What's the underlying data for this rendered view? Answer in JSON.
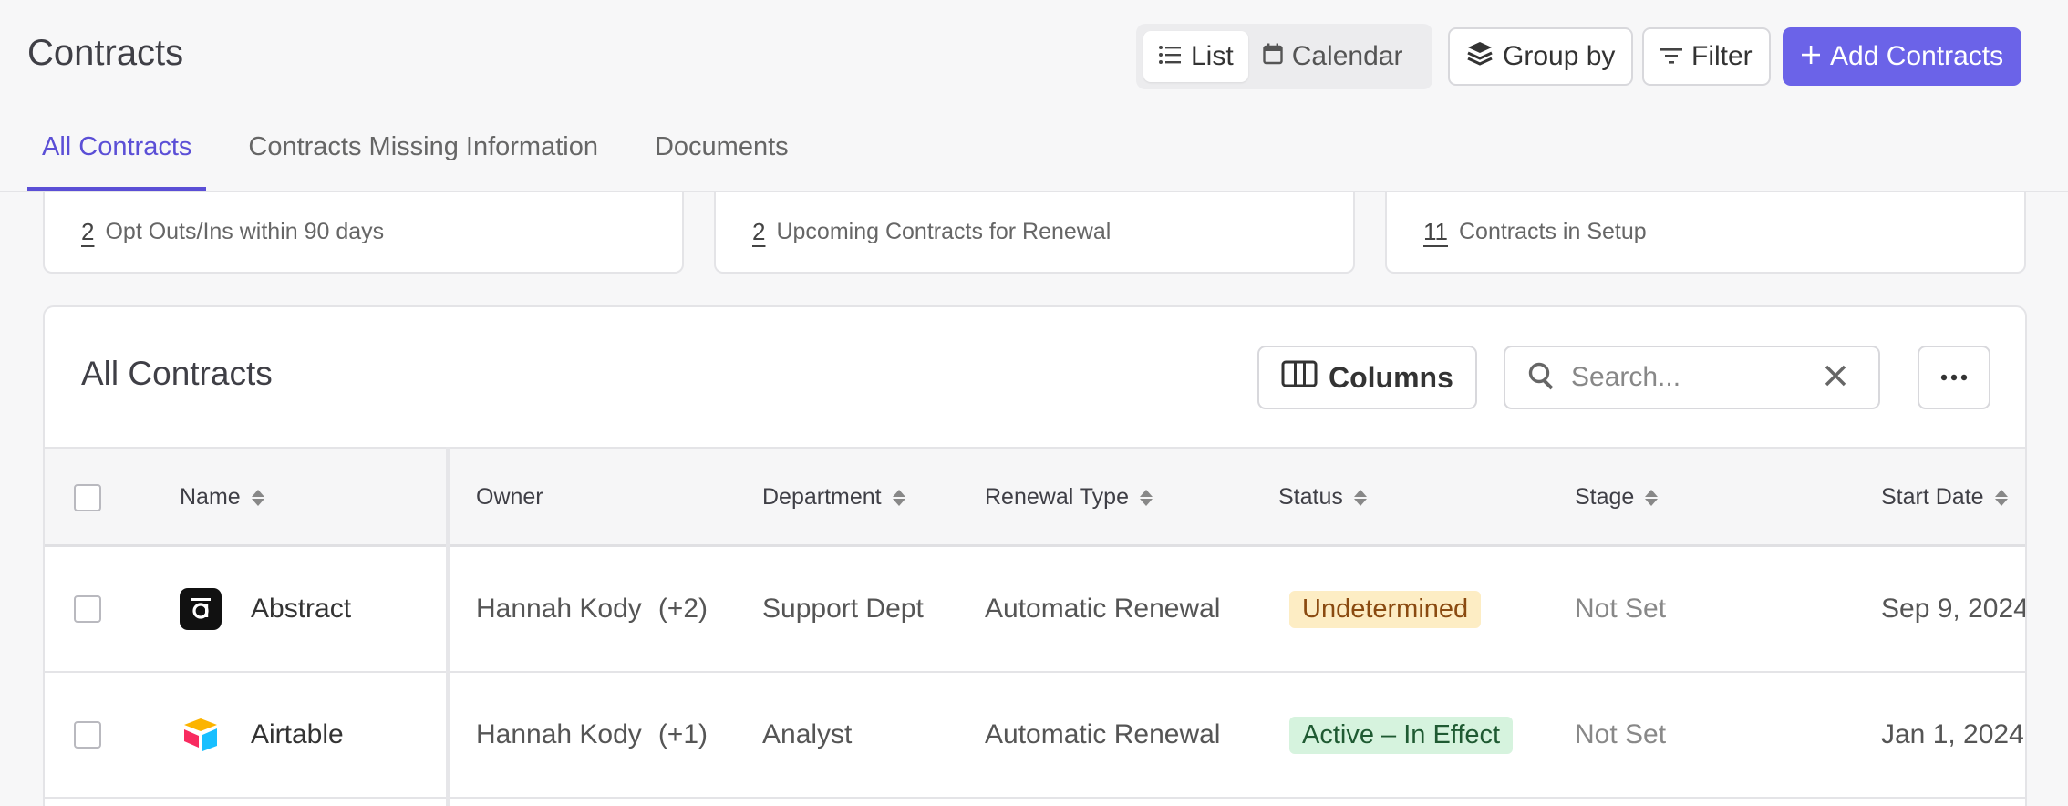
{
  "header": {
    "title": "Contracts",
    "view_list": "List",
    "view_calendar": "Calendar",
    "group_by": "Group by",
    "filter": "Filter",
    "add": "Add Contracts"
  },
  "tabs": [
    {
      "label": "All Contracts",
      "active": true
    },
    {
      "label": "Contracts Missing Information",
      "active": false
    },
    {
      "label": "Documents",
      "active": false
    }
  ],
  "stats": [
    {
      "count": "2",
      "label": "Opt Outs/Ins within 90 days"
    },
    {
      "count": "2",
      "label": "Upcoming Contracts for Renewal"
    },
    {
      "count": "11",
      "label": "Contracts in Setup"
    }
  ],
  "panel": {
    "title": "All Contracts",
    "columns_label": "Columns",
    "search_placeholder": "Search..."
  },
  "table": {
    "headers": [
      "Name",
      "Owner",
      "Department",
      "Renewal Type",
      "Status",
      "Stage",
      "Start Date"
    ],
    "rows": [
      {
        "name": "Abstract",
        "owner": "Hannah Kody",
        "owner_extra": "(+2)",
        "department": "Support Dept",
        "renewal_type": "Automatic Renewal",
        "status": "Undetermined",
        "stage": "Not Set",
        "start_date": "Sep 9, 2024"
      },
      {
        "name": "Airtable",
        "owner": "Hannah Kody",
        "owner_extra": "(+1)",
        "department": "Analyst",
        "renewal_type": "Automatic Renewal",
        "status": "Active – In Effect",
        "stage": "Not Set",
        "start_date": "Jan 1, 2024"
      }
    ]
  },
  "colors": {
    "accent": "#5b4fd6",
    "primary_button": "#6b63e8",
    "status_warn_bg": "#fdedc4",
    "status_ok_bg": "#d6f3de"
  }
}
